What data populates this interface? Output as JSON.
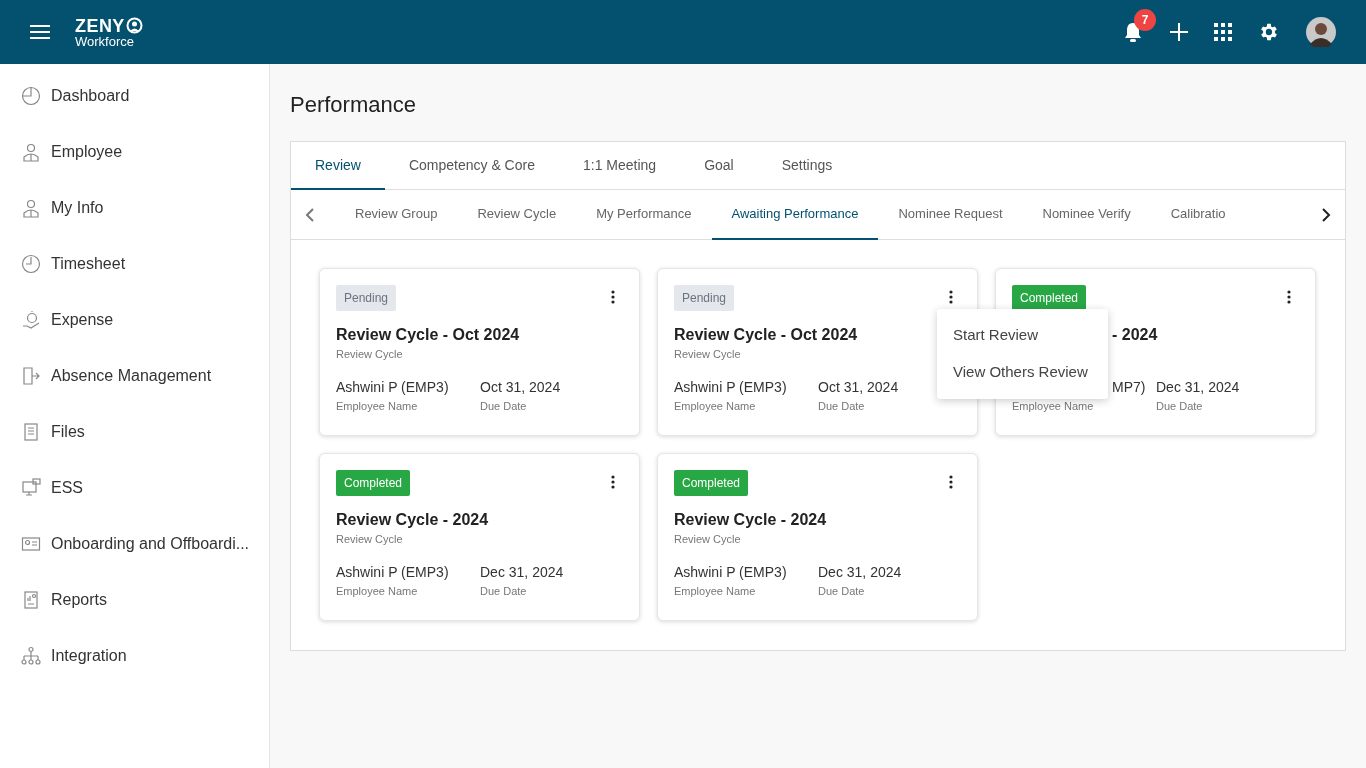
{
  "header": {
    "logo_top": "ZENY",
    "logo_bottom": "Workforce",
    "notification_count": "7"
  },
  "sidebar": {
    "items": [
      {
        "label": "Dashboard"
      },
      {
        "label": "Employee"
      },
      {
        "label": "My Info"
      },
      {
        "label": "Timesheet"
      },
      {
        "label": "Expense"
      },
      {
        "label": "Absence Management"
      },
      {
        "label": "Files"
      },
      {
        "label": "ESS"
      },
      {
        "label": "Onboarding and Offboardi..."
      },
      {
        "label": "Reports"
      },
      {
        "label": "Integration"
      }
    ]
  },
  "page_title": "Performance",
  "tabs": [
    {
      "label": "Review",
      "selected": true
    },
    {
      "label": "Competency & Core",
      "selected": false
    },
    {
      "label": "1:1 Meeting",
      "selected": false
    },
    {
      "label": "Goal",
      "selected": false
    },
    {
      "label": "Settings",
      "selected": false
    }
  ],
  "subtabs": [
    {
      "label": "Review Group",
      "selected": false
    },
    {
      "label": "Review Cycle",
      "selected": false
    },
    {
      "label": "My Performance",
      "selected": false
    },
    {
      "label": "Awaiting Performance",
      "selected": true
    },
    {
      "label": "Nominee Request",
      "selected": false
    },
    {
      "label": "Nominee Verify",
      "selected": false
    },
    {
      "label": "Calibratio",
      "selected": false
    }
  ],
  "cards": [
    {
      "status": "Pending",
      "title": "Review Cycle - Oct 2024",
      "subtitle": "Review Cycle",
      "employee": "Ashwini P (EMP3)",
      "employee_label": "Employee Name",
      "due": "Oct 31, 2024",
      "due_label": "Due Date",
      "kind": "full"
    },
    {
      "status": "Pending",
      "title": "Review Cycle - Oct 2024",
      "subtitle": "Review Cycle",
      "employee": "Ashwini P (EMP3)",
      "employee_label": "Employee Name",
      "due": "Oct 31, 2024",
      "due_label": "Due Date",
      "kind": "full",
      "menu": [
        "Start Review",
        "View Others Review"
      ]
    },
    {
      "status": "Completed",
      "title": "- 2024",
      "employee": "MP7)",
      "employee_label": "Employee Name",
      "due": "Dec 31, 2024",
      "due_label": "Due Date",
      "kind": "overlapped"
    },
    {
      "status": "Completed",
      "title": "Review Cycle - 2024",
      "subtitle": "Review Cycle",
      "employee": "Ashwini P (EMP3)",
      "employee_label": "Employee Name",
      "due": "Dec 31, 2024",
      "due_label": "Due Date",
      "kind": "full"
    },
    {
      "status": "Completed",
      "title": "Review Cycle - 2024",
      "subtitle": "Review Cycle",
      "employee": "Ashwini P (EMP3)",
      "employee_label": "Employee Name",
      "due": "Dec 31, 2024",
      "due_label": "Due Date",
      "kind": "full"
    }
  ]
}
